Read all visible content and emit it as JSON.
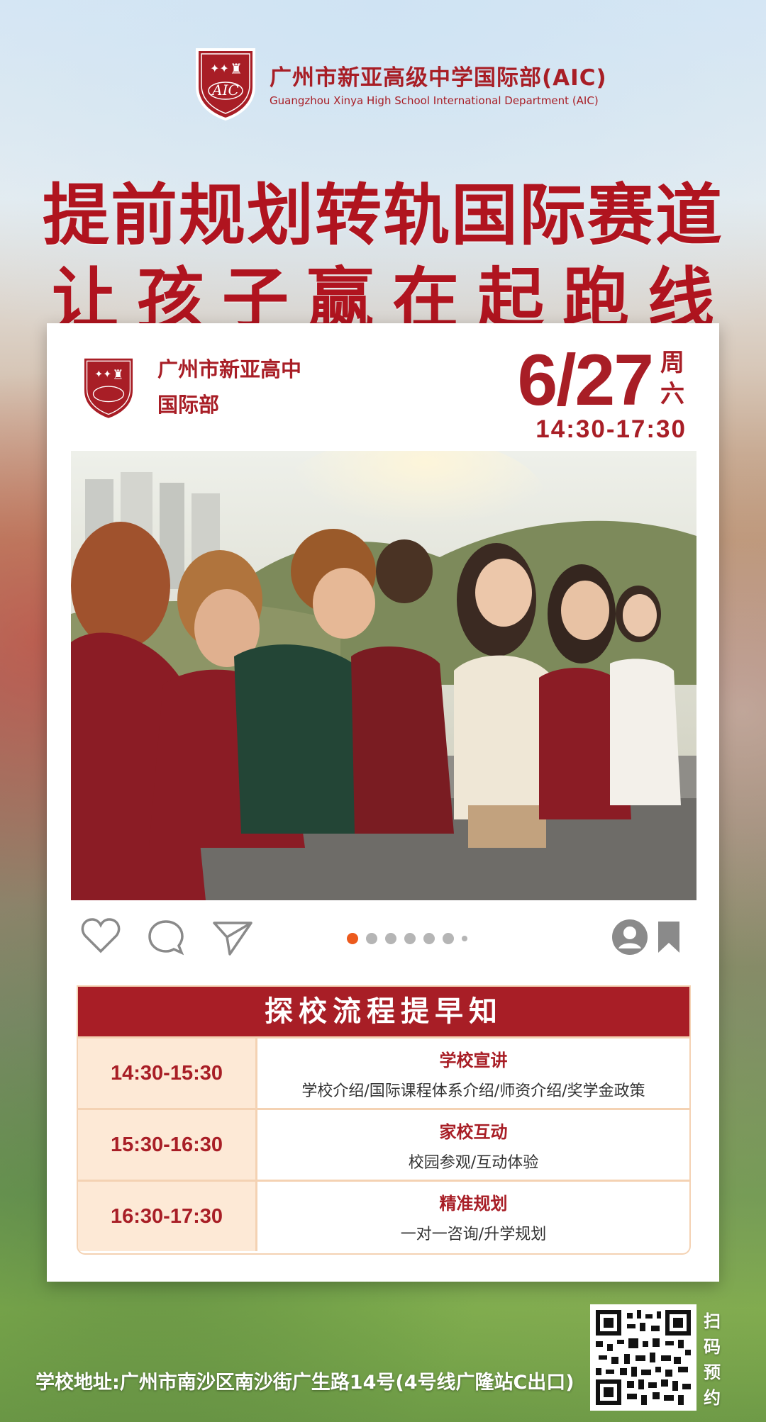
{
  "brand": {
    "name_cn": "广州市新亚高级中学国际部(AIC)",
    "name_en": "Guangzhou Xinya High School International Department (AIC)",
    "logo_text": "AIC"
  },
  "headline": {
    "line1": "提前规划转轨国际赛道",
    "line2": "让孩子赢在起跑线"
  },
  "card": {
    "school_line1": "广州市新亚高中",
    "school_line2": "国际部",
    "date": "6/27",
    "weekday_1": "周",
    "weekday_2": "六",
    "time": "14:30-17:30",
    "photo_label": "students-photo",
    "dots_count": 7,
    "active_dot": 0
  },
  "schedule": {
    "title": "探校流程提早知",
    "rows": [
      {
        "time": "14:30-15:30",
        "title": "学校宣讲",
        "desc": "学校介绍/国际课程体系介绍/师资介绍/奖学金政策"
      },
      {
        "time": "15:30-16:30",
        "title": "家校互动",
        "desc": "校园参观/互动体验"
      },
      {
        "time": "16:30-17:30",
        "title": "精准规划",
        "desc": "一对一咨询/升学规划"
      }
    ]
  },
  "footer": {
    "address": "学校地址:广州市南沙区南沙街广生路14号(4号线广隆站C出口)",
    "qr_text_1": "扫",
    "qr_text_2": "码",
    "qr_text_3": "预",
    "qr_text_4": "约"
  },
  "colors": {
    "brand_red": "#a81e26",
    "accent_orange": "#ec5a1d",
    "table_fill": "#fde9d6"
  }
}
